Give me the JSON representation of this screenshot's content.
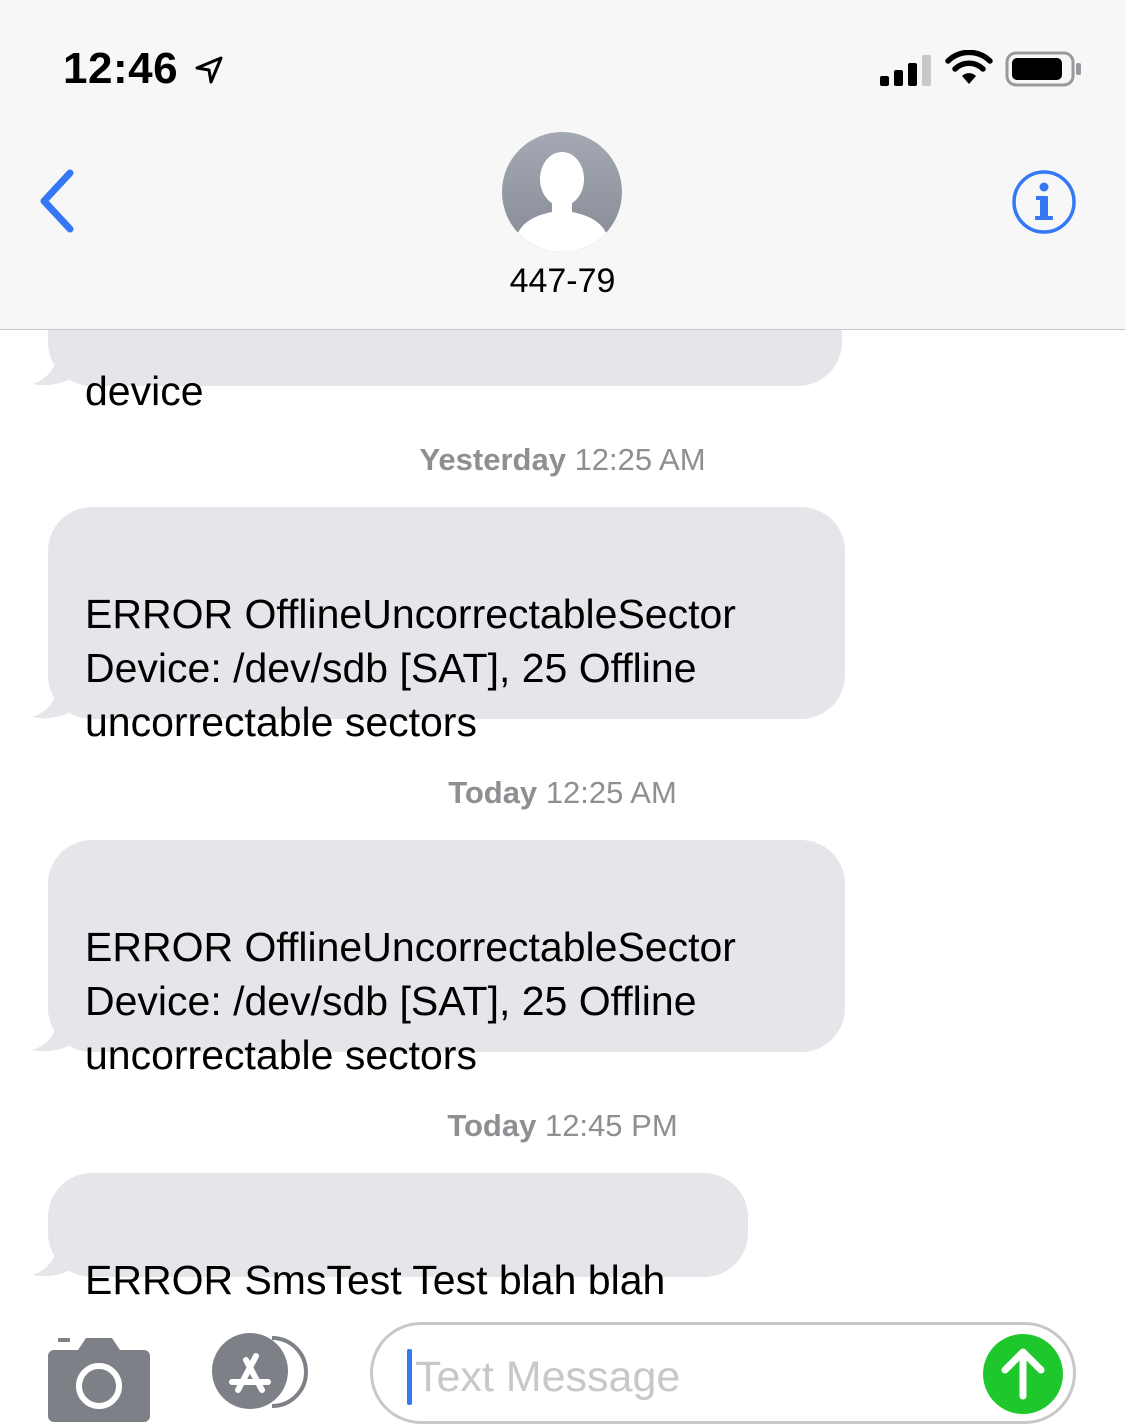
{
  "status_bar": {
    "time": "12:46"
  },
  "header": {
    "contact_name": "447-79"
  },
  "conversation": {
    "partial_message": "device",
    "groups": [
      {
        "day": "Yesterday",
        "time": "12:25 AM",
        "message": "ERROR OfflineUncorrectableSector\nDevice: /dev/sdb [SAT], 25 Offline\nuncorrectable sectors"
      },
      {
        "day": "Today",
        "time": "12:25 AM",
        "message": "ERROR OfflineUncorrectableSector\nDevice: /dev/sdb [SAT], 25 Offline\nuncorrectable sectors"
      },
      {
        "day": "Today",
        "time": "12:45 PM",
        "message": "ERROR SmsTest Test blah blah"
      }
    ]
  },
  "input_bar": {
    "placeholder": "Text Message"
  },
  "colors": {
    "accent": "#3478f6",
    "bubble": "#e5e5ea",
    "send": "#1ec72c",
    "timestamp": "#8e8e93"
  }
}
